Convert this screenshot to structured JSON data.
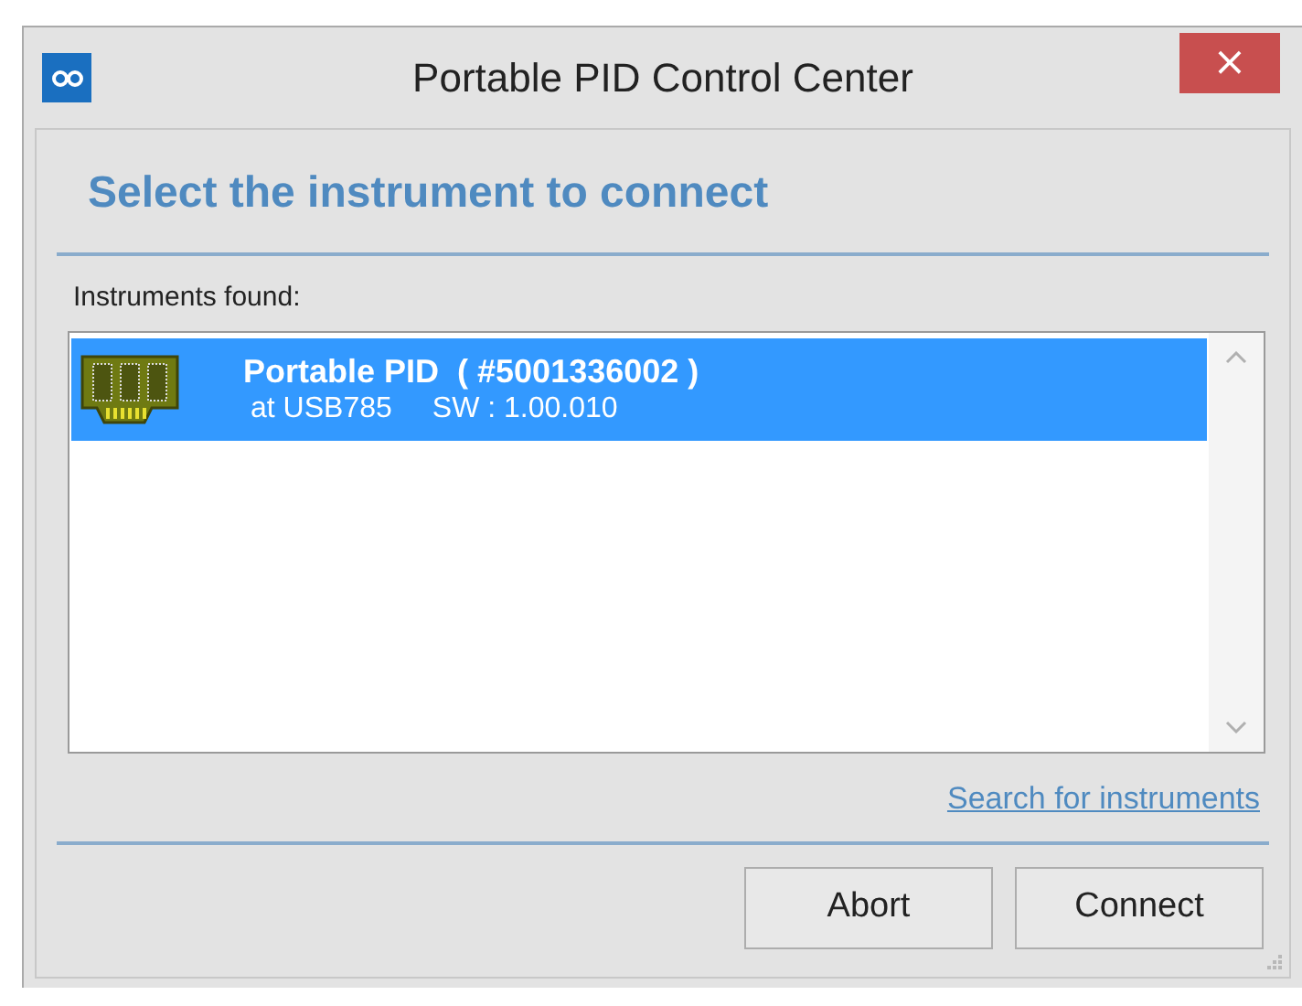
{
  "window": {
    "title": "Portable PID Control Center",
    "close": "×"
  },
  "heading": "Select the instrument to connect",
  "list_label": "Instruments found:",
  "instruments": [
    {
      "name": "Portable PID  ( #5001336002 )",
      "port": "at USB785",
      "software": "SW : 1.00.010",
      "selected": true
    }
  ],
  "link": "Search for instruments",
  "buttons": [
    "Abort",
    "Connect"
  ]
}
